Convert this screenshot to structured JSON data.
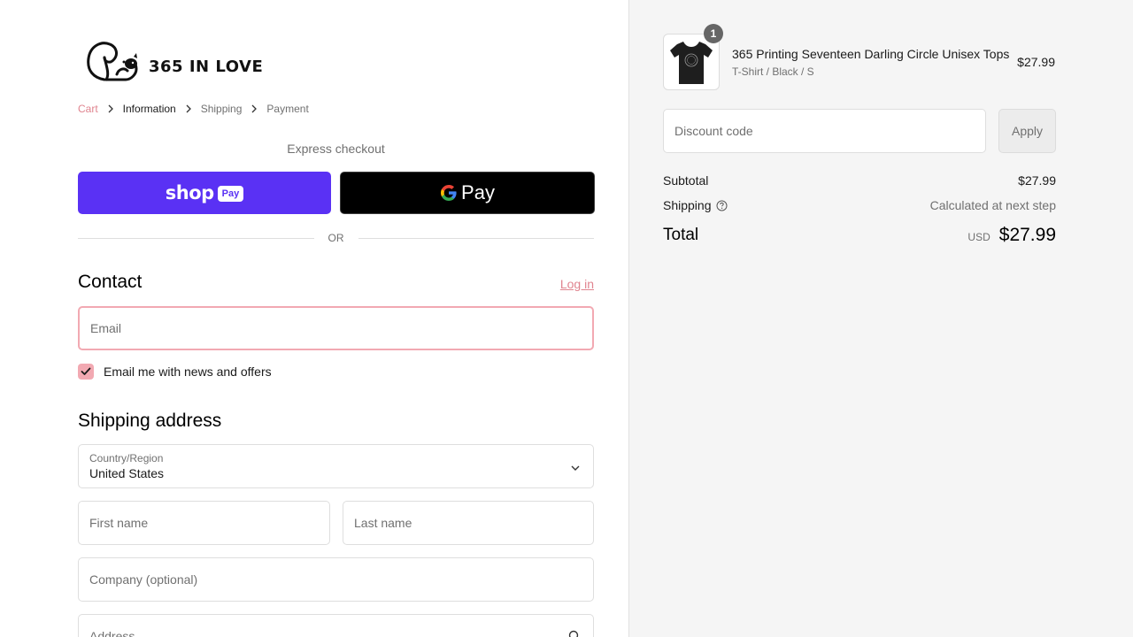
{
  "brand": {
    "logo_text": "365 IN LOVE"
  },
  "breadcrumb": {
    "items": [
      {
        "label": "Cart",
        "state": "link"
      },
      {
        "label": "Information",
        "state": "active"
      },
      {
        "label": "Shipping",
        "state": "inactive"
      },
      {
        "label": "Payment",
        "state": "inactive"
      }
    ]
  },
  "express": {
    "title": "Express checkout",
    "shop_pay_word": "shop",
    "shop_pay_pill": "Pay",
    "gpay_label": "Pay"
  },
  "divider": {
    "text": "OR"
  },
  "contact": {
    "title": "Contact",
    "login_label": "Log in",
    "email_placeholder": "Email",
    "newsletter_label": "Email me with news and offers",
    "newsletter_checked": true
  },
  "shipping": {
    "title": "Shipping address",
    "country_label": "Country/Region",
    "country_value": "United States",
    "first_name_placeholder": "First name",
    "last_name_placeholder": "Last name",
    "company_placeholder": "Company (optional)",
    "address_placeholder": "Address"
  },
  "summary": {
    "product": {
      "name": "365 Printing Seventeen Darling Circle Unisex Tops",
      "variant": "T-Shirt / Black / S",
      "price": "$27.99",
      "quantity": "1"
    },
    "discount_placeholder": "Discount code",
    "apply_label": "Apply",
    "subtotal_label": "Subtotal",
    "subtotal_value": "$27.99",
    "shipping_label": "Shipping",
    "shipping_value": "Calculated at next step",
    "total_label": "Total",
    "currency": "USD",
    "total_value": "$27.99"
  },
  "colors": {
    "accent": "#e0848f",
    "accent_light": "#f2a9b2",
    "shop_pay": "#5a31f4",
    "gpay": "#000000"
  }
}
